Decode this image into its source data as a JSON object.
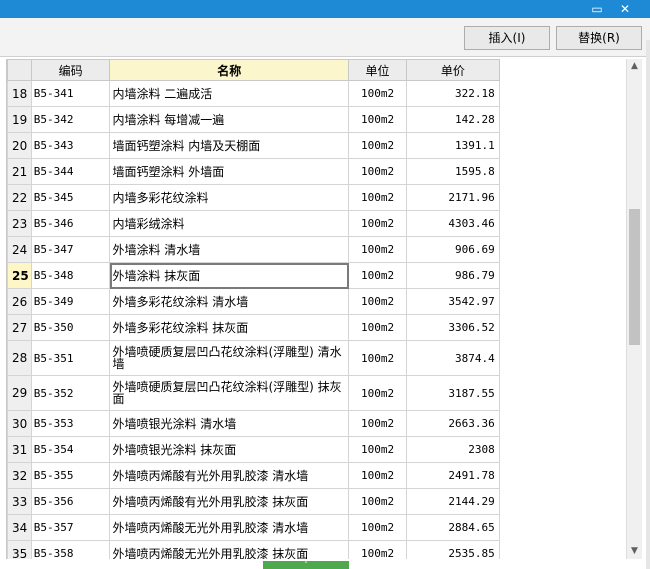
{
  "window": {
    "minimize_glyph": "▭",
    "close_glyph": "✕"
  },
  "toolbar": {
    "insert_label": "插入(I)",
    "replace_label": "替换(R)"
  },
  "table": {
    "headers": {
      "code": "编码",
      "name": "名称",
      "unit": "单位",
      "price": "单价"
    },
    "rows": [
      {
        "n": "18",
        "code": "B5-341",
        "name": "内墙涂料 二遍成活",
        "unit": "100m2",
        "price": "322.18"
      },
      {
        "n": "19",
        "code": "B5-342",
        "name": "内墙涂料 每增减一遍",
        "unit": "100m2",
        "price": "142.28"
      },
      {
        "n": "20",
        "code": "B5-343",
        "name": "墙面钙塑涂料 内墙及天棚面",
        "unit": "100m2",
        "price": "1391.1"
      },
      {
        "n": "21",
        "code": "B5-344",
        "name": "墙面钙塑涂料 外墙面",
        "unit": "100m2",
        "price": "1595.8"
      },
      {
        "n": "22",
        "code": "B5-345",
        "name": "内墙多彩花纹涂料",
        "unit": "100m2",
        "price": "2171.96"
      },
      {
        "n": "23",
        "code": "B5-346",
        "name": "内墙彩绒涂料",
        "unit": "100m2",
        "price": "4303.46"
      },
      {
        "n": "24",
        "code": "B5-347",
        "name": "外墙涂料 清水墙",
        "unit": "100m2",
        "price": "906.69"
      },
      {
        "n": "25",
        "code": "B5-348",
        "name": "外墙涂料 抹灰面",
        "unit": "100m2",
        "price": "986.79"
      },
      {
        "n": "26",
        "code": "B5-349",
        "name": "外墙多彩花纹涂料 清水墙",
        "unit": "100m2",
        "price": "3542.97"
      },
      {
        "n": "27",
        "code": "B5-350",
        "name": "外墙多彩花纹涂料 抹灰面",
        "unit": "100m2",
        "price": "3306.52"
      },
      {
        "n": "28",
        "code": "B5-351",
        "name": "外墙喷硬质复层凹凸花纹涂料(浮雕型) 清水墙",
        "unit": "100m2",
        "price": "3874.4"
      },
      {
        "n": "29",
        "code": "B5-352",
        "name": "外墙喷硬质复层凹凸花纹涂料(浮雕型) 抹灰面",
        "unit": "100m2",
        "price": "3187.55"
      },
      {
        "n": "30",
        "code": "B5-353",
        "name": "外墙喷银光涂料 清水墙",
        "unit": "100m2",
        "price": "2663.36"
      },
      {
        "n": "31",
        "code": "B5-354",
        "name": "外墙喷银光涂料 抹灰面",
        "unit": "100m2",
        "price": "2308"
      },
      {
        "n": "32",
        "code": "B5-355",
        "name": "外墙喷丙烯酸有光外用乳胶漆 清水墙",
        "unit": "100m2",
        "price": "2491.78"
      },
      {
        "n": "33",
        "code": "B5-356",
        "name": "外墙喷丙烯酸有光外用乳胶漆 抹灰面",
        "unit": "100m2",
        "price": "2144.29"
      },
      {
        "n": "34",
        "code": "B5-357",
        "name": "外墙喷丙烯酸无光外用乳胶漆 清水墙",
        "unit": "100m2",
        "price": "2884.65"
      },
      {
        "n": "35",
        "code": "B5-358",
        "name": "外墙喷丙烯酸无光外用乳胶漆 抹灰面",
        "unit": "100m2",
        "price": "2535.85"
      }
    ]
  },
  "selection": {
    "row_number": "25"
  },
  "scrollbar": {
    "up_glyph": "▲",
    "down_glyph": "▼"
  },
  "bottom_handle_glyph": "˄",
  "colors": {
    "titlebar": "#1e8ad6",
    "name_header": "#fbf6cc",
    "current_row": "#fff6c8"
  }
}
